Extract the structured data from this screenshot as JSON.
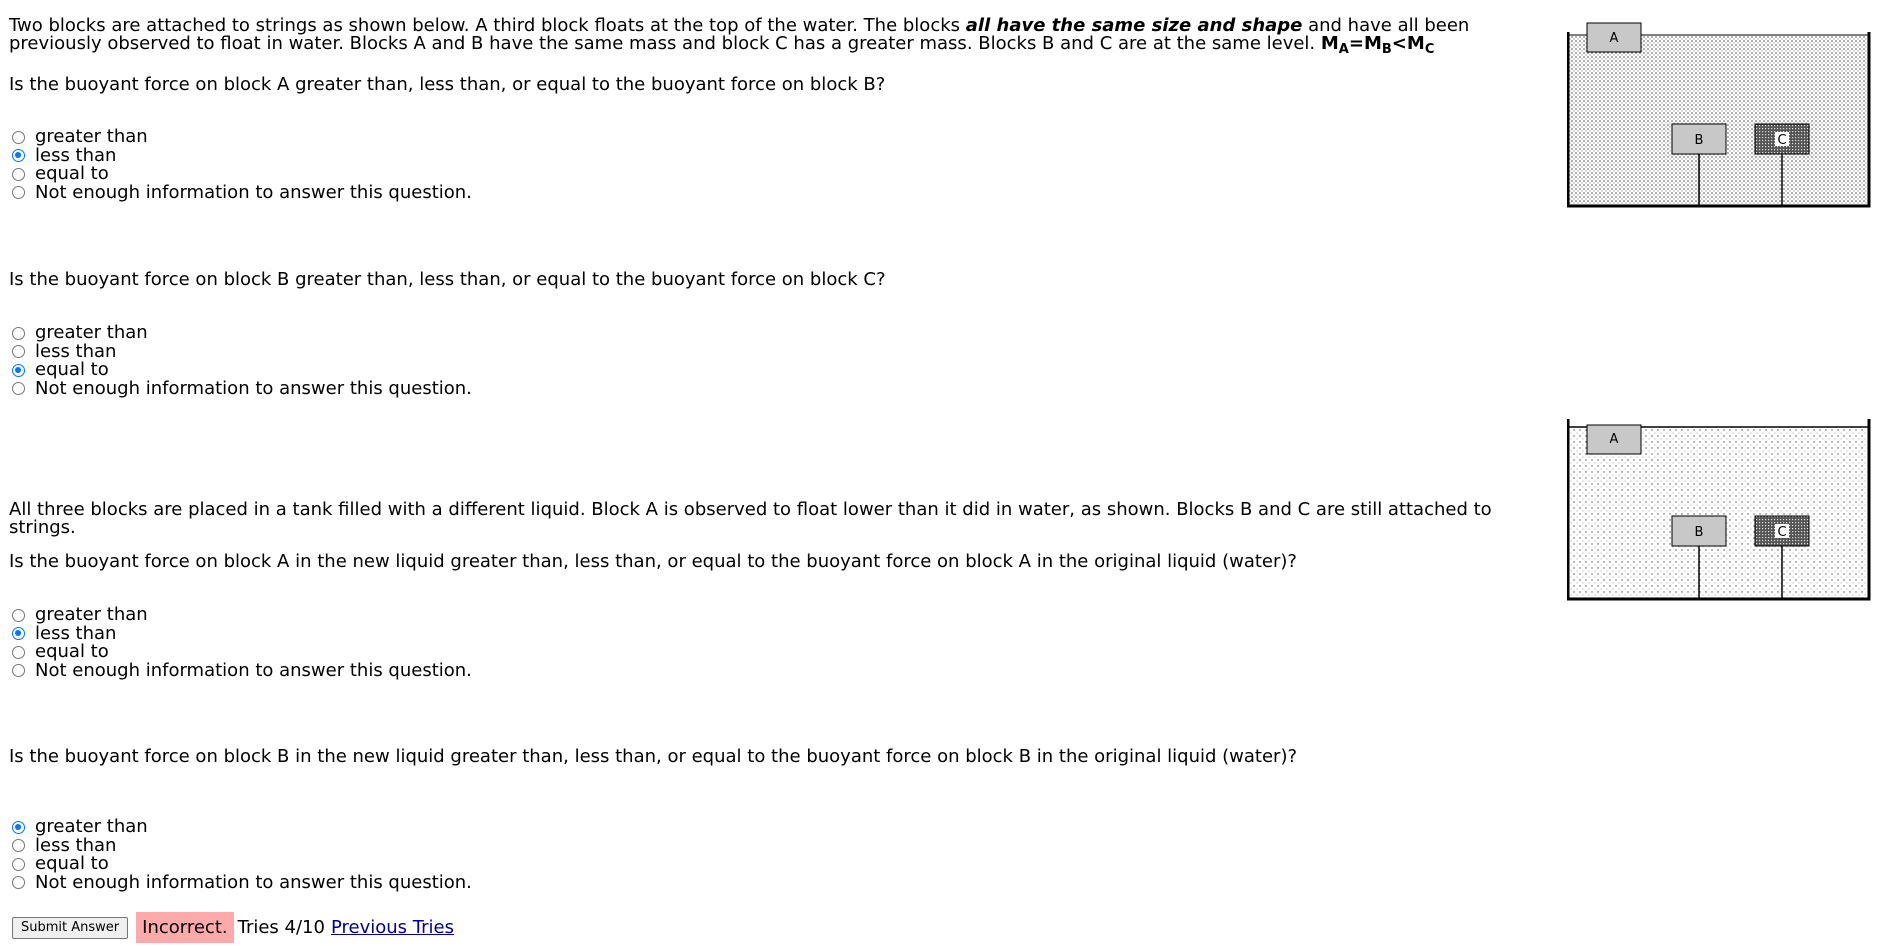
{
  "intro": {
    "part1": "Two blocks are attached to strings as shown below.  A third block floats at the top of the water.  The blocks ",
    "emphasis": "all have the same size and shape",
    "part2": " and have all been previously observed to float in water.  Blocks A and B have the same mass and block C has a greater mass.  Blocks B and C are at the same level. ",
    "formula": {
      "m1": "M",
      "s1": "A",
      "eq": "=",
      "m2": "M",
      "s2": "B",
      "lt": "<",
      "m3": "M",
      "s3": "C"
    }
  },
  "q1": {
    "text": "Is the buoyant force on block A greater than, less than, or equal to the buoyant force on block B?",
    "options": [
      "greater than",
      "less than",
      "equal to",
      "Not enough information to answer this question."
    ],
    "selected": 1
  },
  "q2": {
    "text": "Is the buoyant force on block B greater than, less than, or equal to the buoyant force on block C?",
    "options": [
      "greater than",
      "less than",
      "equal to",
      "Not enough information to answer this question."
    ],
    "selected": 2
  },
  "part2_intro": "All three blocks are placed in a tank filled with a different liquid.  Block A is observed to float lower than it did in water, as shown.  Blocks B and C are still attached to strings.",
  "q3": {
    "text": "Is the buoyant force on block A in the new liquid greater than, less than, or equal to the buoyant force on block A in the original liquid (water)?",
    "options": [
      "greater than",
      "less than",
      "equal to",
      "Not enough information to answer this question."
    ],
    "selected": 1
  },
  "q4": {
    "text": "Is the buoyant force on block B in the new liquid greater than, less than, or equal to the buoyant force on block B in the original liquid (water)?",
    "options": [
      "greater than",
      "less than",
      "equal to",
      "Not enough information to answer this question."
    ],
    "selected": 0
  },
  "footer": {
    "submit_label": "Submit Answer",
    "status": "Incorrect.",
    "tries": "Tries 4/10",
    "previous_tries": "Previous Tries"
  },
  "diagram1": {
    "block_a": "A",
    "block_b": "B",
    "block_c": "C"
  },
  "diagram2": {
    "block_a": "A",
    "block_b": "B",
    "block_c": "C"
  },
  "colors": {
    "radio_checked": "#0075ff",
    "status_bg": "#ffaaaa",
    "link": "#00008b",
    "block_c_fill": "#555555",
    "block_ab_fill": "#c8c8c8"
  }
}
